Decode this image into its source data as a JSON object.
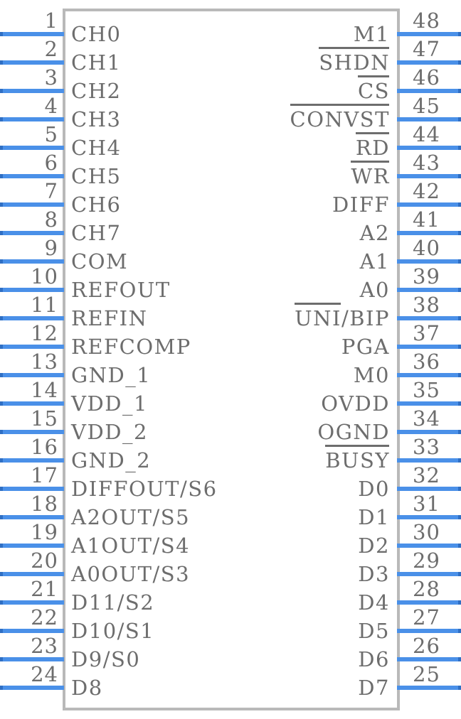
{
  "symbol": {
    "title": "48-pin IC schematic symbol",
    "body_color": "#b9b9b9",
    "pin_color": "#4a90e8",
    "text_color": "#6d6d6d",
    "pin_count": 48,
    "pins_per_side": 24
  },
  "pins": {
    "left": [
      {
        "number": "1",
        "name": "CH0",
        "overline": ""
      },
      {
        "number": "2",
        "name": "CH1",
        "overline": ""
      },
      {
        "number": "3",
        "name": "CH2",
        "overline": ""
      },
      {
        "number": "4",
        "name": "CH3",
        "overline": ""
      },
      {
        "number": "5",
        "name": "CH4",
        "overline": ""
      },
      {
        "number": "6",
        "name": "CH5",
        "overline": ""
      },
      {
        "number": "7",
        "name": "CH6",
        "overline": ""
      },
      {
        "number": "8",
        "name": "CH7",
        "overline": ""
      },
      {
        "number": "9",
        "name": "COM",
        "overline": ""
      },
      {
        "number": "10",
        "name": "REFOUT",
        "overline": ""
      },
      {
        "number": "11",
        "name": "REFIN",
        "overline": ""
      },
      {
        "number": "12",
        "name": "REFCOMP",
        "overline": ""
      },
      {
        "number": "13",
        "name": "GND_1",
        "overline": ""
      },
      {
        "number": "14",
        "name": "VDD_1",
        "overline": ""
      },
      {
        "number": "15",
        "name": "VDD_2",
        "overline": ""
      },
      {
        "number": "16",
        "name": "GND_2",
        "overline": ""
      },
      {
        "number": "17",
        "name": "DIFFOUT/S6",
        "overline": ""
      },
      {
        "number": "18",
        "name": "A2OUT/S5",
        "overline": ""
      },
      {
        "number": "19",
        "name": "A1OUT/S4",
        "overline": ""
      },
      {
        "number": "20",
        "name": "A0OUT/S3",
        "overline": ""
      },
      {
        "number": "21",
        "name": "D11/S2",
        "overline": ""
      },
      {
        "number": "22",
        "name": "D10/S1",
        "overline": ""
      },
      {
        "number": "23",
        "name": "D9/S0",
        "overline": ""
      },
      {
        "number": "24",
        "name": "D8",
        "overline": ""
      }
    ],
    "right": [
      {
        "number": "48",
        "name": "M1",
        "overline": ""
      },
      {
        "number": "47",
        "name": "SHDN",
        "overline": "SHDN"
      },
      {
        "number": "46",
        "name": "CS",
        "overline": "CS"
      },
      {
        "number": "45",
        "name": "CONVST",
        "overline": "CONVST"
      },
      {
        "number": "44",
        "name": "RD",
        "overline": "RD"
      },
      {
        "number": "43",
        "name": "WR",
        "overline": "WR"
      },
      {
        "number": "42",
        "name": "DIFF",
        "overline": ""
      },
      {
        "number": "41",
        "name": "A2",
        "overline": ""
      },
      {
        "number": "40",
        "name": "A1",
        "overline": ""
      },
      {
        "number": "39",
        "name": "A0",
        "overline": ""
      },
      {
        "number": "38",
        "name": "UNI/BIP",
        "overline": "UNI"
      },
      {
        "number": "37",
        "name": "PGA",
        "overline": ""
      },
      {
        "number": "36",
        "name": "M0",
        "overline": ""
      },
      {
        "number": "35",
        "name": "OVDD",
        "overline": ""
      },
      {
        "number": "34",
        "name": "OGND",
        "overline": ""
      },
      {
        "number": "33",
        "name": "BUSY",
        "overline": "BUSY"
      },
      {
        "number": "32",
        "name": "D0",
        "overline": ""
      },
      {
        "number": "31",
        "name": "D1",
        "overline": ""
      },
      {
        "number": "30",
        "name": "D2",
        "overline": ""
      },
      {
        "number": "29",
        "name": "D3",
        "overline": ""
      },
      {
        "number": "28",
        "name": "D4",
        "overline": ""
      },
      {
        "number": "27",
        "name": "D5",
        "overline": ""
      },
      {
        "number": "26",
        "name": "D6",
        "overline": ""
      },
      {
        "number": "25",
        "name": "D7",
        "overline": ""
      }
    ]
  }
}
